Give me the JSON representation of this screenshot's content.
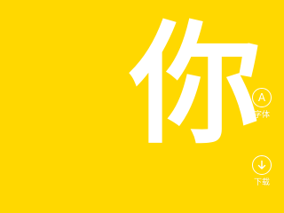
{
  "preview": {
    "character": "你",
    "background_color": "#ffd800",
    "glyph_color": "#ffffff"
  },
  "actions": {
    "font": {
      "icon": "font-letter-a-icon",
      "icon_glyph": "A",
      "label": "字体"
    },
    "download": {
      "icon": "download-arrow-icon",
      "label": "下载"
    }
  }
}
